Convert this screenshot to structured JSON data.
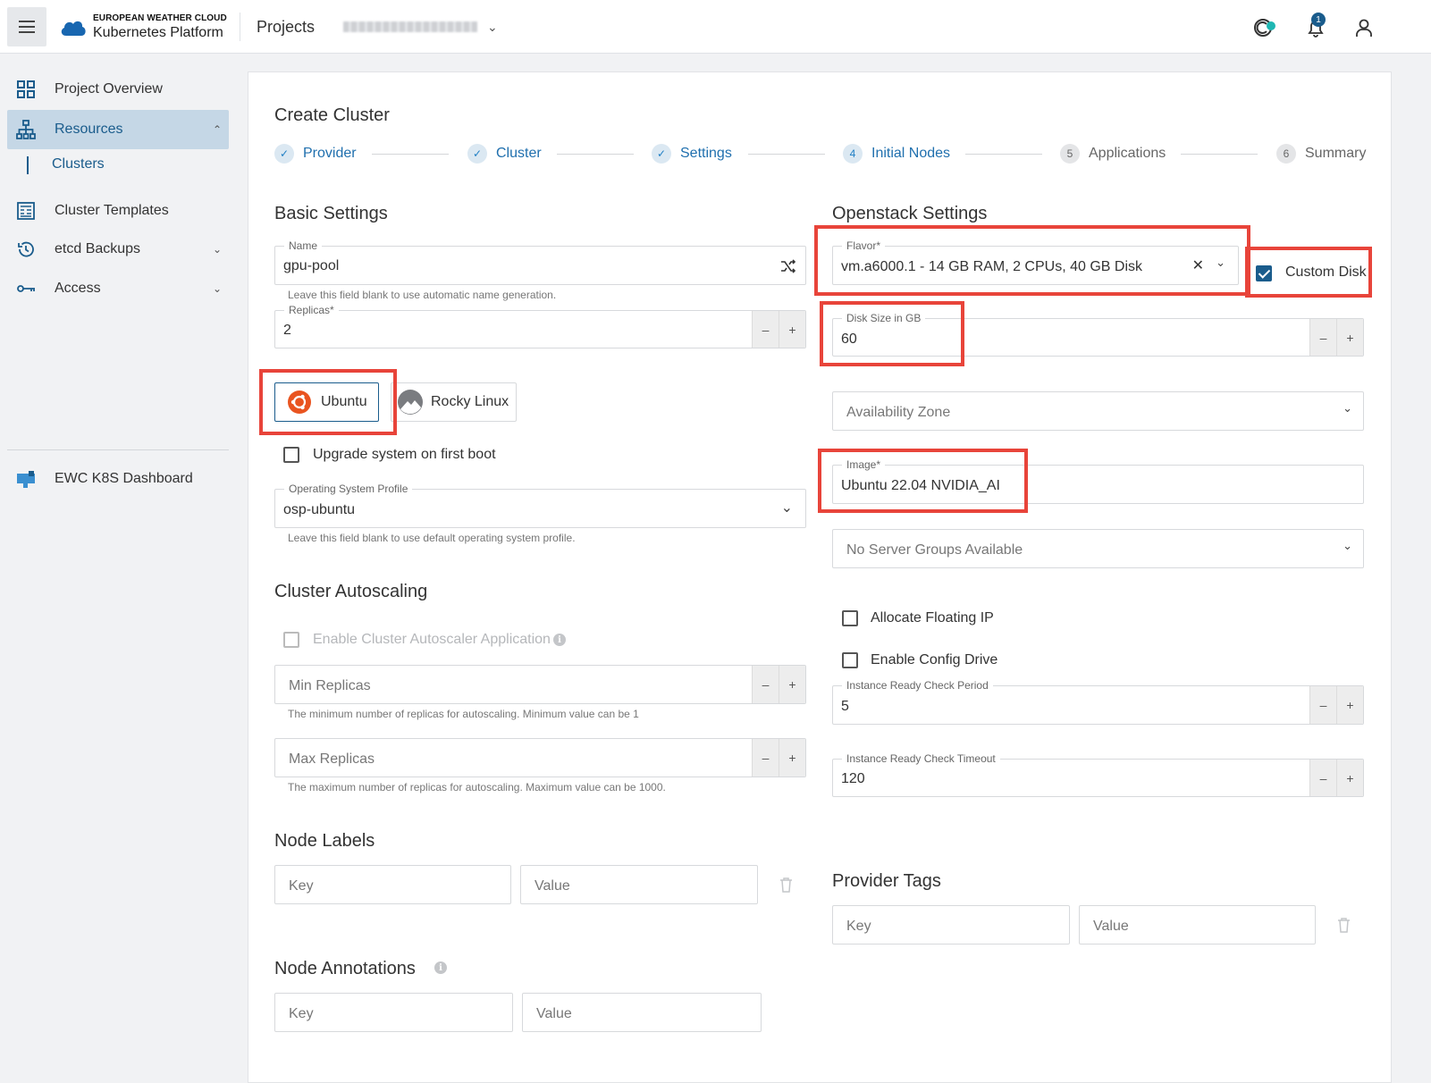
{
  "topbar": {
    "brand_top": "EUROPEAN WEATHER CLOUD",
    "brand_bottom": "Kubernetes Platform",
    "projects_label": "Projects",
    "notification_count": "1"
  },
  "sidebar": {
    "items": [
      {
        "label": "Project Overview",
        "icon": "grid-icon"
      },
      {
        "label": "Resources",
        "icon": "hierarchy-icon"
      },
      {
        "label": "Clusters"
      },
      {
        "label": "Cluster Templates",
        "icon": "template-icon"
      },
      {
        "label": "etcd Backups",
        "icon": "history-icon"
      },
      {
        "label": "Access",
        "icon": "key-icon"
      },
      {
        "label": "EWC K8S Dashboard",
        "icon": "dashboard-icon"
      }
    ]
  },
  "page": {
    "title": "Create Cluster",
    "steps": [
      {
        "label": "Provider",
        "num": "✓"
      },
      {
        "label": "Cluster",
        "num": "✓"
      },
      {
        "label": "Settings",
        "num": "✓"
      },
      {
        "label": "Initial Nodes",
        "num": "4"
      },
      {
        "label": "Applications",
        "num": "5"
      },
      {
        "label": "Summary",
        "num": "6"
      }
    ]
  },
  "basic": {
    "title": "Basic Settings",
    "name_label": "Name",
    "name_value": "gpu-pool",
    "name_hint": "Leave this field blank to use automatic name generation.",
    "replicas_label": "Replicas*",
    "replicas_value": "2",
    "os_ubuntu": "Ubuntu",
    "os_rocky": "Rocky Linux",
    "upgrade_label": "Upgrade system on first boot",
    "osp_label": "Operating System Profile",
    "osp_value": "osp-ubuntu",
    "osp_hint": "Leave this field blank to use default operating system profile."
  },
  "autoscaling": {
    "title": "Cluster Autoscaling",
    "enable_label": "Enable Cluster Autoscaler Application",
    "min_placeholder": "Min Replicas",
    "min_hint": "The minimum number of replicas for autoscaling. Minimum value can be 1",
    "max_placeholder": "Max Replicas",
    "max_hint": "The maximum number of replicas for autoscaling. Maximum value can be 1000."
  },
  "node_labels": {
    "title": "Node Labels",
    "key_placeholder": "Key",
    "value_placeholder": "Value"
  },
  "node_annotations": {
    "title": "Node Annotations",
    "key_placeholder": "Key",
    "value_placeholder": "Value"
  },
  "openstack": {
    "title": "Openstack Settings",
    "flavor_label": "Flavor*",
    "flavor_value": "vm.a6000.1 - 14 GB RAM, 2 CPUs, 40 GB Disk",
    "custom_disk_label": "Custom Disk",
    "disk_label": "Disk Size in GB",
    "disk_value": "60",
    "az_placeholder": "Availability Zone",
    "image_label": "Image*",
    "image_value": "Ubuntu 22.04 NVIDIA_AI",
    "server_groups_placeholder": "No Server Groups Available",
    "floating_ip_label": "Allocate Floating IP",
    "config_drive_label": "Enable Config Drive",
    "ready_period_label": "Instance Ready Check Period",
    "ready_period_value": "5",
    "ready_timeout_label": "Instance Ready Check Timeout",
    "ready_timeout_value": "120"
  },
  "provider_tags": {
    "title": "Provider Tags",
    "key_placeholder": "Key",
    "value_placeholder": "Value"
  },
  "colors": {
    "accent": "#1a5c8c",
    "highlight": "#e8443a"
  }
}
